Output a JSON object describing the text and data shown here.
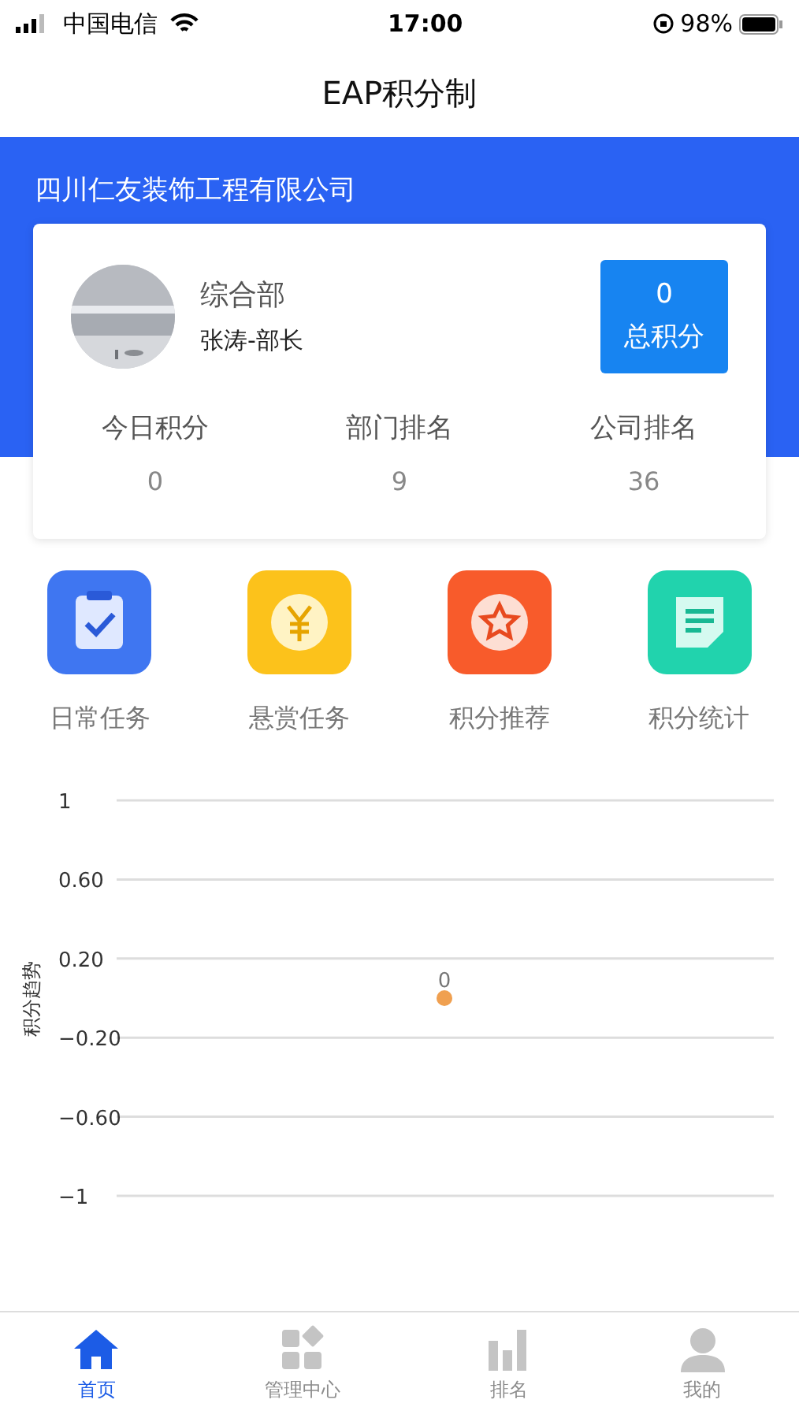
{
  "status_bar": {
    "carrier": "中国电信",
    "time": "17:00",
    "battery": "98%"
  },
  "nav_bar": {
    "title": "EAP积分制"
  },
  "company": "四川仁友装饰工程有限公司",
  "profile": {
    "department": "综合部",
    "person": "张涛-部长",
    "total": {
      "value": "0",
      "label": "总积分"
    }
  },
  "stats": [
    {
      "label": "今日积分",
      "value": "0"
    },
    {
      "label": "部门排名",
      "value": "9"
    },
    {
      "label": "公司排名",
      "value": "36"
    }
  ],
  "shortcuts": [
    {
      "kind": "clipboard",
      "label": "日常任务",
      "color": "#3f76f1"
    },
    {
      "kind": "yen",
      "label": "悬赏任务",
      "color": "#fcc21b"
    },
    {
      "kind": "star",
      "label": "积分推荐",
      "color": "#f85b2b"
    },
    {
      "kind": "note",
      "label": "积分统计",
      "color": "#21d3ad"
    }
  ],
  "chart": {
    "chart_data": {
      "type": "line",
      "ylabel": "积分趋势",
      "ylim": [
        -1,
        1
      ],
      "yticks": [
        {
          "value": 1,
          "label": "1"
        },
        {
          "value": 0.6,
          "label": "0.60"
        },
        {
          "value": 0.2,
          "label": "0.20"
        },
        {
          "value": -0.2,
          "label": "−0.20"
        },
        {
          "value": -0.6,
          "label": "−0.60"
        },
        {
          "value": -1,
          "label": "−1"
        }
      ],
      "series": [
        {
          "color": "#f0a050",
          "marker": "circle",
          "values": [
            0
          ]
        }
      ],
      "grid": true,
      "data_labels": true
    }
  },
  "tab_bar": [
    {
      "kind": "home",
      "label": "首页",
      "selected": true
    },
    {
      "kind": "grid",
      "label": "管理中心",
      "selected": false
    },
    {
      "kind": "bars",
      "label": "排名",
      "selected": false
    },
    {
      "kind": "user",
      "label": "我的",
      "selected": false
    }
  ]
}
